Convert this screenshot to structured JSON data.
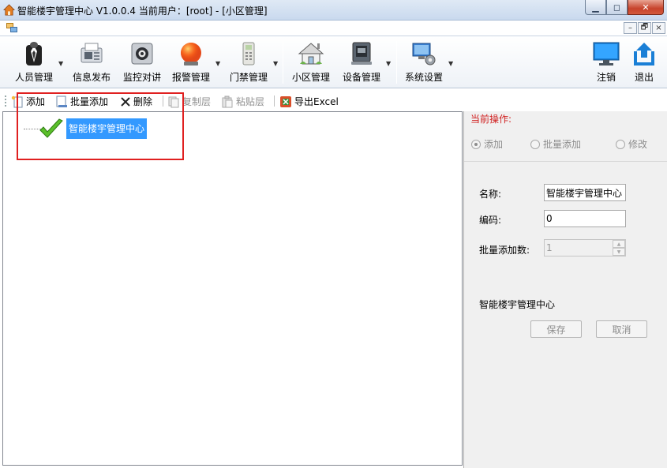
{
  "window": {
    "title": "智能楼宇管理中心 V1.0.0.4   当前用户：[root] - [小区管理]",
    "minimize_glyph": "▁",
    "maximize_glyph": "◻",
    "close_glyph": "✕"
  },
  "mdi": {
    "minimize_glyph": "–",
    "restore_glyph": "🗗",
    "close_glyph": "×"
  },
  "toolbar": {
    "items": [
      {
        "label": "人员管理",
        "icon": "person-suit-icon"
      },
      {
        "label": "信息发布",
        "icon": "fax-icon"
      },
      {
        "label": "监控对讲",
        "icon": "camera-icon"
      },
      {
        "label": "报警管理",
        "icon": "alarm-light-icon"
      },
      {
        "label": "门禁管理",
        "icon": "door-panel-icon"
      },
      {
        "label": "小区管理",
        "icon": "house-icon"
      },
      {
        "label": "设备管理",
        "icon": "device-icon"
      },
      {
        "label": "系统设置",
        "icon": "monitor-gear-icon"
      },
      {
        "label": "注销",
        "icon": "monitor-icon"
      },
      {
        "label": "退出",
        "icon": "exit-arrow-icon"
      }
    ]
  },
  "subtoolbar": {
    "add": "添加",
    "batch_add": "批量添加",
    "delete": "删除",
    "copy_layer": "复制层",
    "paste_layer": "粘贴层",
    "export_excel": "导出Excel"
  },
  "tree": {
    "root_label": "智能楼宇管理中心"
  },
  "panel": {
    "op_title": "当前操作:",
    "radios": [
      {
        "label": "添加",
        "checked": true
      },
      {
        "label": "批量添加",
        "checked": false
      },
      {
        "label": "修改",
        "checked": false
      }
    ],
    "name_label": "名称:",
    "name_value": "智能楼宇管理中心",
    "code_label": "编码:",
    "code_value": "0",
    "batch_label": "批量添加数:",
    "batch_value": "1",
    "node_name": "智能楼宇管理中心",
    "save": "保存",
    "cancel": "取消"
  },
  "colors": {
    "selection": "#3399ff",
    "highlight_box": "#e02020",
    "op_title": "#d02020"
  }
}
